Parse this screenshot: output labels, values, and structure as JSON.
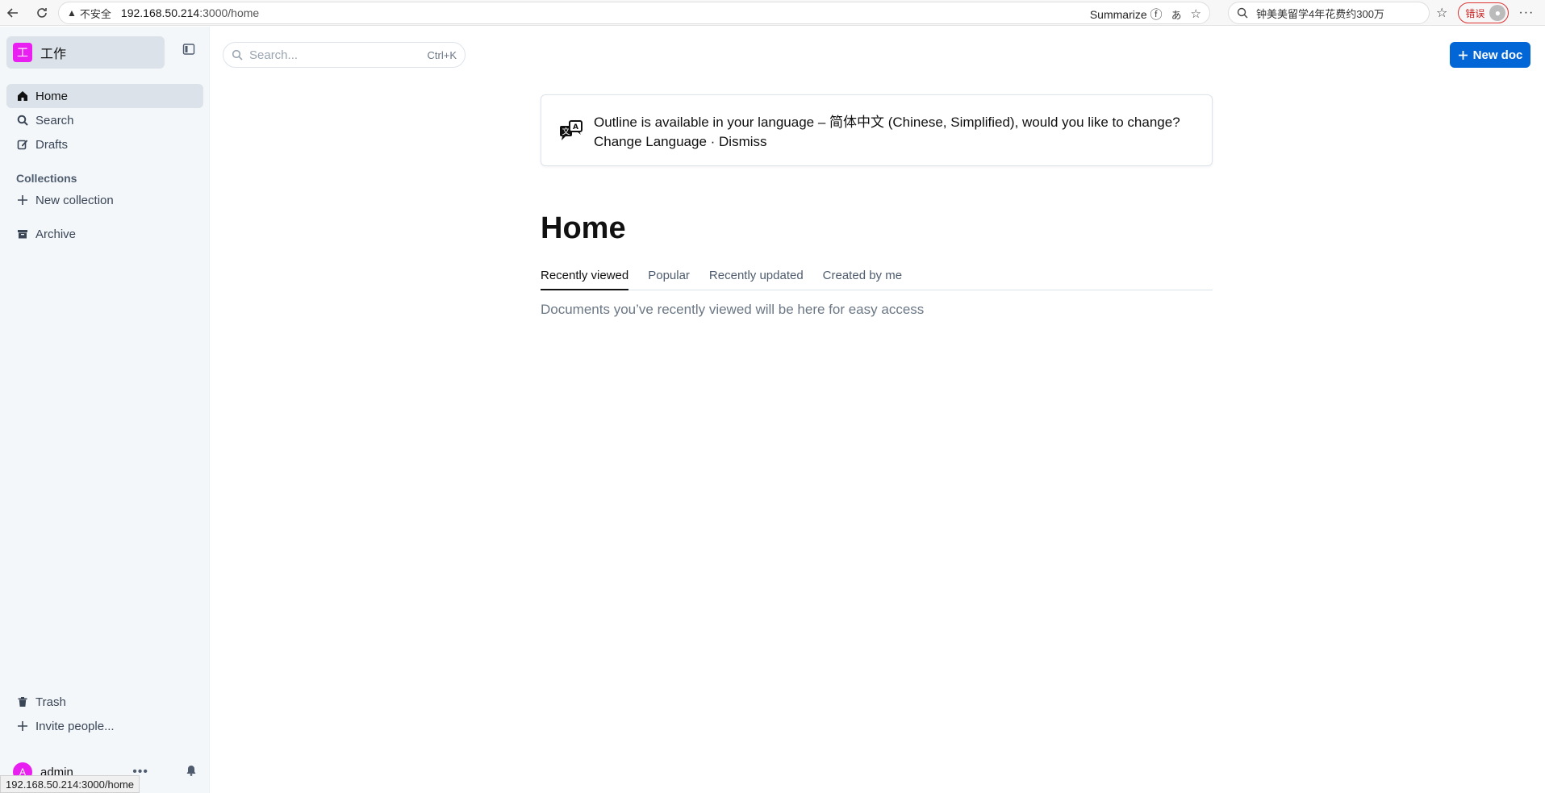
{
  "browser": {
    "security_label": "不安全",
    "url_host": "192.168.50.214",
    "url_path": ":3000/home",
    "summarize_label": "Summarize",
    "search_query": "钟美美留学4年花费约300万",
    "error_label": "错误"
  },
  "sidebar": {
    "team_initial": "工",
    "team_name": "工作",
    "items": [
      {
        "label": "Home",
        "icon": "home-icon"
      },
      {
        "label": "Search",
        "icon": "search-icon"
      },
      {
        "label": "Drafts",
        "icon": "edit-icon"
      }
    ],
    "collections_label": "Collections",
    "new_collection_label": "New collection",
    "archive_label": "Archive",
    "trash_label": "Trash",
    "invite_label": "Invite people...",
    "user_initial": "A",
    "user_name": "admin"
  },
  "header": {
    "search_placeholder": "Search...",
    "search_shortcut": "Ctrl+K",
    "new_doc_label": "New doc"
  },
  "notice": {
    "message": "Outline is available in your language – 简体中文 (Chinese, Simplified), would you like to change?",
    "change_label": "Change Language",
    "separator": " · ",
    "dismiss_label": "Dismiss"
  },
  "main": {
    "title": "Home",
    "tabs": [
      "Recently viewed",
      "Popular",
      "Recently updated",
      "Created by me"
    ],
    "empty_message": "Documents you’ve recently viewed will be here for easy access"
  },
  "statusbar": {
    "url": "192.168.50.214:3000/home"
  },
  "colors": {
    "accent": "#0366d6",
    "team_logo": "#e81ff0",
    "sidebar_bg": "#f4f7fa"
  }
}
